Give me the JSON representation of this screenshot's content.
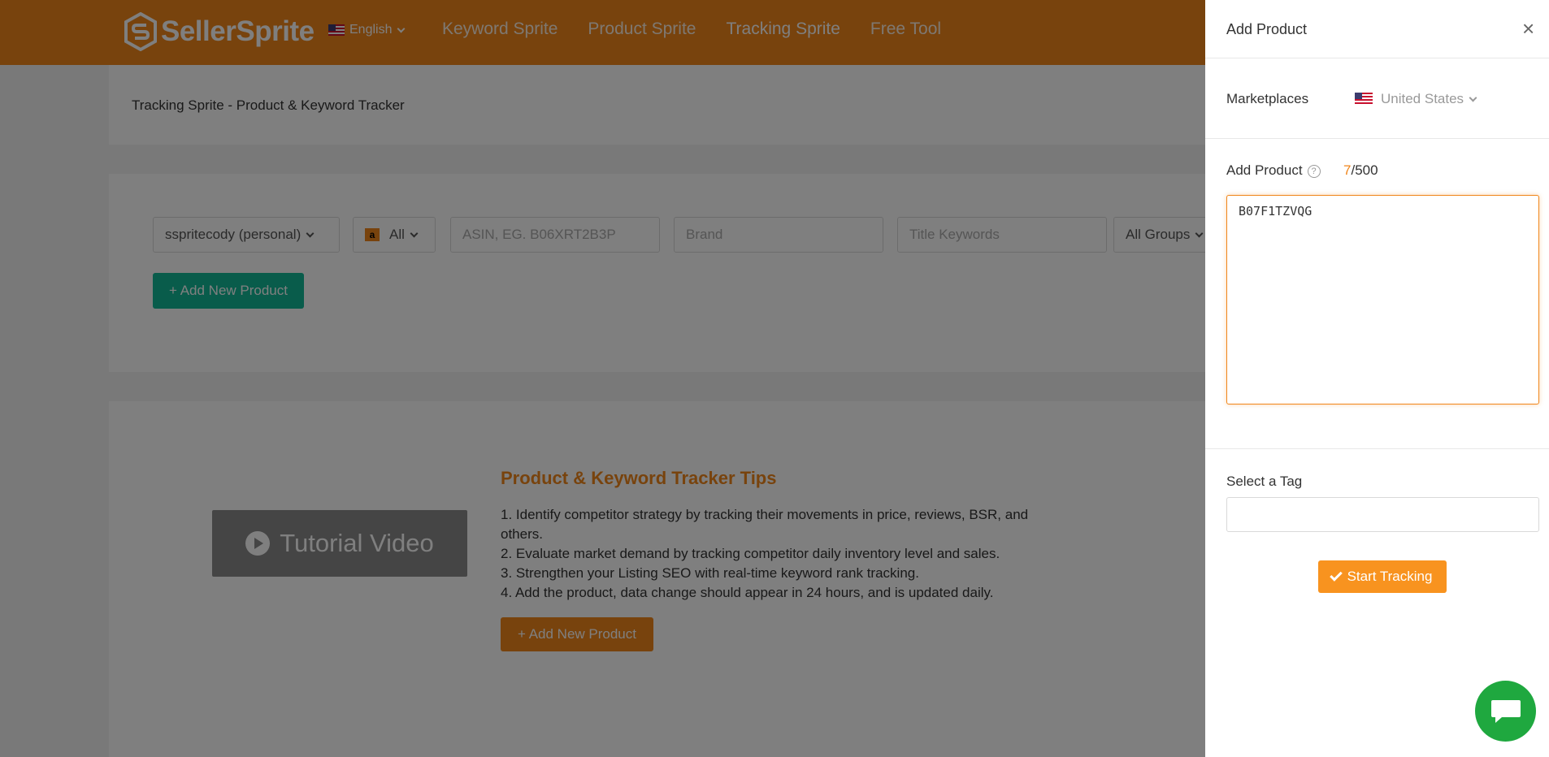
{
  "brand": {
    "name": "SellerSprite",
    "logo_icon": "sellersprite-logo-icon"
  },
  "header": {
    "language": "English",
    "nav": [
      "Keyword Sprite",
      "Product Sprite",
      "Tracking Sprite",
      "Free Tool"
    ],
    "active_nav": "Tracking Sprite",
    "accent_color": "#f0861b"
  },
  "page": {
    "title": "Tracking Sprite - Product & Keyword Tracker",
    "filters": {
      "account": "sspritecody (personal)",
      "marketplace": "All",
      "asin_placeholder": "ASIN, EG. B06XRT2B3P",
      "brand_placeholder": "Brand",
      "title_placeholder": "Title Keywords",
      "group": "All Groups"
    },
    "add_new_product": "+ Add New Product",
    "tips": {
      "video_label": "Tutorial Video",
      "title": "Product & Keyword Tracker Tips",
      "items": [
        "1. Identify competitor strategy by tracking their movements in price, reviews, BSR, and others.",
        "2. Evaluate market demand by tracking competitor daily inventory level and sales.",
        "3. Strengthen your Listing SEO with real-time keyword rank tracking.",
        "4. Add the product, data change should appear in 24 hours, and is updated daily."
      ],
      "add_button": "+ Add New Product"
    }
  },
  "drawer": {
    "title": "Add Product",
    "close": "×",
    "marketplaces_label": "Marketplaces",
    "marketplace_value": "United States",
    "add_product_label": "Add Product",
    "count_current": "7",
    "count_total": "/500",
    "textarea_value": "B07F1TZVQG",
    "tag_label": "Select a Tag",
    "tag_value": "",
    "start_button": "Start Tracking",
    "button_color": "#f8931f"
  },
  "chat": {
    "icon": "chat-bubble-icon",
    "color": "#1fa83f"
  }
}
